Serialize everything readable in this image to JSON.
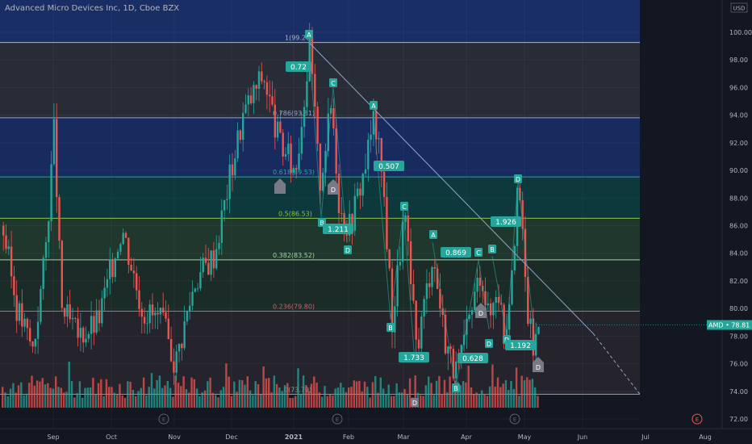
{
  "header": {
    "title": "Advanced Micro Devices Inc, 1D, Cboe BZX"
  },
  "price_axis": {
    "currency_badge": "USD",
    "ticks": [
      "100.00",
      "98.00",
      "96.00",
      "94.00",
      "92.00",
      "90.00",
      "88.00",
      "86.00",
      "84.00",
      "82.00",
      "80.00",
      "78.00",
      "76.00",
      "74.00",
      "72.00"
    ],
    "top_partial": "100.00"
  },
  "time_axis": {
    "labels": [
      "Sep",
      "Oct",
      "Nov",
      "Dec",
      "2021",
      "Feb",
      "Mar",
      "Apr",
      "May",
      "Jun",
      "Jul",
      "Aug"
    ]
  },
  "last_price": {
    "label": "AMD",
    "value": "78.81"
  },
  "earnings_marker": "E",
  "fib_levels": [
    {
      "ratio": "1",
      "price": 99.26,
      "text": "1(99.26)"
    },
    {
      "ratio": "0.786",
      "price": 93.81,
      "text": "0.786(93.81)"
    },
    {
      "ratio": "0.618",
      "price": 89.53,
      "text": "0.618(89.53)"
    },
    {
      "ratio": "0.5",
      "price": 86.53,
      "text": "0.5(86.53)"
    },
    {
      "ratio": "0.382",
      "price": 83.52,
      "text": "0.382(83.52)"
    },
    {
      "ratio": "0.236",
      "price": 79.8,
      "text": "0.236(79.80)"
    },
    {
      "ratio": "0",
      "price": 73.79,
      "text": "0(73.79)"
    }
  ],
  "pattern_labels": {
    "letters": [
      "A",
      "B",
      "C",
      "D",
      "A",
      "B",
      "C",
      "D",
      "A",
      "B",
      "C",
      "D",
      "B",
      "D",
      "D",
      "D"
    ],
    "ratios": [
      "0.72",
      "1.211",
      "0.507",
      "1.733",
      "0.869",
      "0.628",
      "1.926",
      "1.192"
    ]
  },
  "chart_data": {
    "type": "candlestick",
    "title": "Advanced Micro Devices Inc, 1D, Cboe BZX",
    "symbol": "AMD",
    "last": 78.81,
    "ylim": [
      71.3,
      102.0
    ],
    "x_labels": [
      "Sep",
      "Oct",
      "Nov",
      "Dec",
      "2021",
      "Feb",
      "Mar",
      "Apr",
      "May",
      "Jun",
      "Jul",
      "Aug"
    ],
    "fib_retracement": {
      "from": 99.26,
      "to": 73.79
    },
    "trendline": {
      "start_price": 99.26,
      "end_price": 73.8
    },
    "key_points": [
      {
        "label": "A",
        "price": 99.3
      },
      {
        "label": "B",
        "price": 86.6
      },
      {
        "label": "C",
        "price": 96.0
      },
      {
        "label": "D",
        "price": 84.8
      },
      {
        "label": "A",
        "price": 94.0
      },
      {
        "label": "B",
        "price": 79.2
      },
      {
        "label": "C",
        "price": 87.1
      },
      {
        "label": "B",
        "price": 74.3
      },
      {
        "label": "C",
        "price": 89.3
      },
      {
        "label": "D",
        "price": 76.6
      }
    ]
  }
}
